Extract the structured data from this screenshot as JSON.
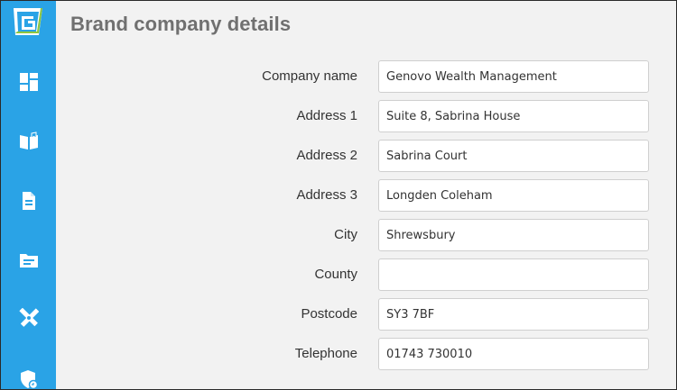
{
  "page": {
    "title": "Brand company details"
  },
  "sidebar": {
    "items": [
      {
        "name": "dashboard",
        "icon": "dashboard-icon"
      },
      {
        "name": "library",
        "icon": "open-book-icon"
      },
      {
        "name": "documents",
        "icon": "document-icon"
      },
      {
        "name": "folders",
        "icon": "folder-icon"
      },
      {
        "name": "tools",
        "icon": "pencil-ruler-icon"
      },
      {
        "name": "security",
        "icon": "shield-icon"
      }
    ],
    "color": "#2aa3e6"
  },
  "form": {
    "fields": [
      {
        "label": "Company name",
        "value": "Genovo Wealth Management"
      },
      {
        "label": "Address 1",
        "value": "Suite 8, Sabrina House"
      },
      {
        "label": "Address 2",
        "value": "Sabrina Court"
      },
      {
        "label": "Address 3",
        "value": "Longden Coleham"
      },
      {
        "label": "City",
        "value": "Shrewsbury"
      },
      {
        "label": "County",
        "value": ""
      },
      {
        "label": "Postcode",
        "value": "SY3 7BF"
      },
      {
        "label": "Telephone",
        "value": "01743 730010"
      }
    ]
  }
}
